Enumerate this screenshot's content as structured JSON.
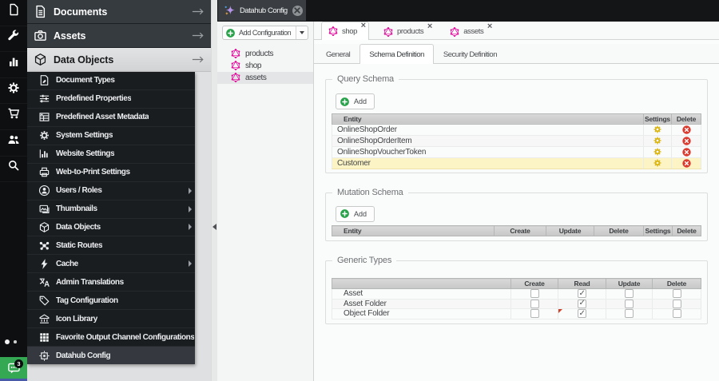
{
  "window": {
    "top_tab": {
      "label": "Datahub Config",
      "icon": "datahub-sparkle-icon",
      "close_icon": "close-circle-icon"
    }
  },
  "icon_strip": {
    "icons": [
      "file-icon",
      "wrench-icon",
      "bar-chart-icon",
      "gear-icon",
      "shopping-cart-icon",
      "users-icon",
      "search-icon"
    ],
    "chat": {
      "icon": "chat-bubble-icon",
      "badge": "3"
    }
  },
  "accordion": {
    "items": [
      {
        "label": "Documents",
        "icon": "document-icon",
        "active": false
      },
      {
        "label": "Assets",
        "icon": "camera-icon",
        "active": false
      },
      {
        "label": "Data Objects",
        "icon": "cube-icon",
        "active": true
      }
    ]
  },
  "settings_menu": {
    "items": [
      {
        "label": "Document Types",
        "icon": "document-types-icon",
        "has_children": false,
        "active": false
      },
      {
        "label": "Predefined Properties",
        "icon": "sliders-icon",
        "has_children": false,
        "active": false
      },
      {
        "label": "Predefined Asset Metadata",
        "icon": "metadata-grid-icon",
        "has_children": false,
        "active": false
      },
      {
        "label": "System Settings",
        "icon": "gear-icon",
        "has_children": false,
        "active": false
      },
      {
        "label": "Website Settings",
        "icon": "chart-icon",
        "has_children": false,
        "active": false
      },
      {
        "label": "Web-to-Print Settings",
        "icon": "printer-icon",
        "has_children": false,
        "active": false
      },
      {
        "label": "Users / Roles",
        "icon": "user-circle-icon",
        "has_children": true,
        "active": false
      },
      {
        "label": "Thumbnails",
        "icon": "image-icon",
        "has_children": true,
        "active": false
      },
      {
        "label": "Data Objects",
        "icon": "cube-icon",
        "has_children": true,
        "active": false
      },
      {
        "label": "Static Routes",
        "icon": "network-icon",
        "has_children": false,
        "active": false
      },
      {
        "label": "Cache",
        "icon": "lightning-icon",
        "has_children": true,
        "active": false
      },
      {
        "label": "Admin Translations",
        "icon": "translate-icon",
        "has_children": false,
        "active": false
      },
      {
        "label": "Tag Configuration",
        "icon": "tag-icon",
        "has_children": false,
        "active": false
      },
      {
        "label": "Icon Library",
        "icon": "bank-icon",
        "has_children": false,
        "active": false
      },
      {
        "label": "Favorite Output Channel Configurations",
        "icon": "grid-icon",
        "has_children": false,
        "active": false
      },
      {
        "label": "Datahub Config",
        "icon": "chip-icon",
        "has_children": false,
        "active": true
      }
    ]
  },
  "tree_panel": {
    "add_button": {
      "label": "Add Configuration",
      "icon": "add-plus-icon",
      "dropdown_icon": "caret-down-icon"
    },
    "items": [
      {
        "label": "products",
        "icon": "graphql-icon",
        "selected": false
      },
      {
        "label": "shop",
        "icon": "graphql-icon",
        "selected": false
      },
      {
        "label": "assets",
        "icon": "graphql-icon",
        "selected": true
      }
    ]
  },
  "main": {
    "tabs": [
      {
        "label": "shop",
        "icon": "graphql-icon",
        "active": true
      },
      {
        "label": "products",
        "icon": "graphql-icon",
        "active": false
      },
      {
        "label": "assets",
        "icon": "graphql-icon",
        "active": false
      }
    ],
    "close_glyph": "×",
    "subtabs": [
      {
        "label": "General",
        "active": false
      },
      {
        "label": "Schema Definition",
        "active": true
      },
      {
        "label": "Security Definition",
        "active": false
      }
    ],
    "query_schema": {
      "legend": "Query Schema",
      "add_label": "Add",
      "columns": {
        "entity": "Entity",
        "settings": "Settings",
        "delete": "Delete"
      },
      "rows": [
        {
          "entity": "OnlineShopOrder",
          "highlight": false
        },
        {
          "entity": "OnlineShopOrderItem",
          "highlight": false
        },
        {
          "entity": "OnlineShopVoucherToken",
          "highlight": false
        },
        {
          "entity": "Customer",
          "highlight": true
        }
      ]
    },
    "mutation_schema": {
      "legend": "Mutation Schema",
      "add_label": "Add",
      "columns": {
        "entity": "Entity",
        "create": "Create",
        "update": "Update",
        "delete": "Delete",
        "settings": "Settings",
        "delete2": "Delete"
      },
      "rows": []
    },
    "generic_types": {
      "legend": "Generic Types",
      "columns": {
        "create": "Create",
        "read": "Read",
        "update": "Update",
        "delete": "Delete"
      },
      "rows": [
        {
          "label": "Asset",
          "create": false,
          "read": true,
          "update": false,
          "delete": false,
          "dirty_read": false
        },
        {
          "label": "Asset Folder",
          "create": false,
          "read": true,
          "update": false,
          "delete": false,
          "dirty_read": false
        },
        {
          "label": "Object Folder",
          "create": false,
          "read": true,
          "update": false,
          "delete": false,
          "dirty_read": true
        }
      ]
    }
  },
  "colors": {
    "accent_magenta": "#e10098",
    "add_green": "#28a24a",
    "chat_green": "#34a853",
    "delete_red": "#dc3b30",
    "gear_yellow": "#d9b410",
    "highlight_row": "#fcf4c5"
  }
}
